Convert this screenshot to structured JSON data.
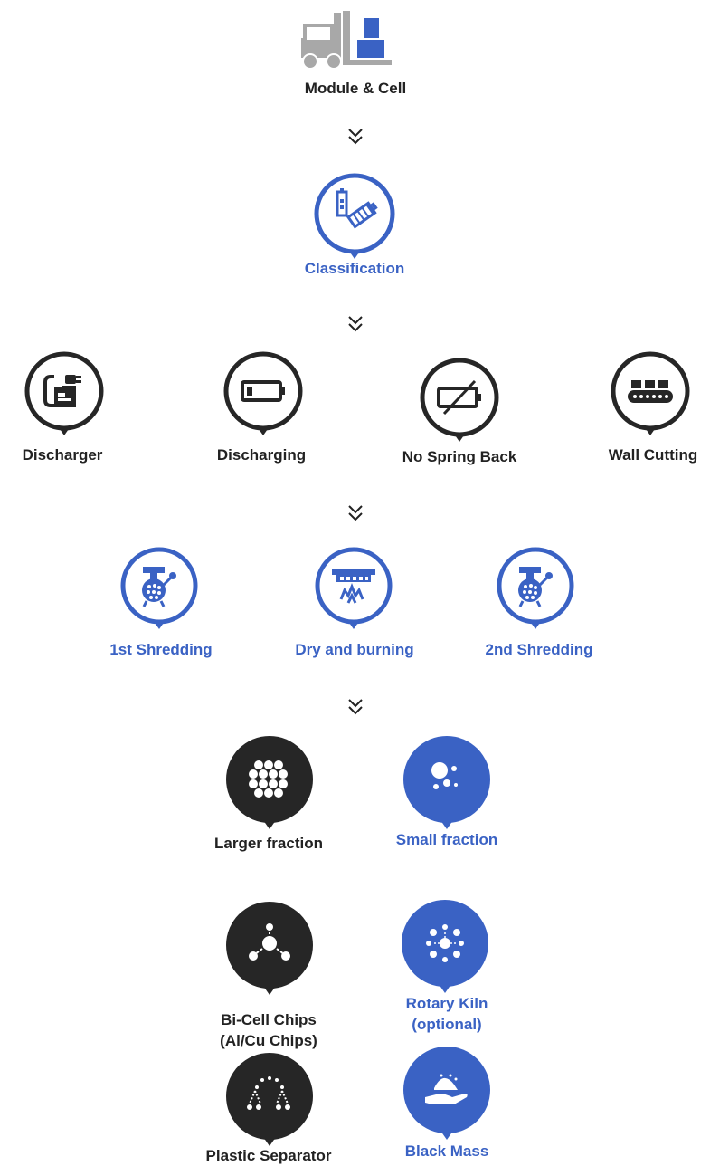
{
  "colors": {
    "blue": "#3a62c4",
    "dark": "#262626",
    "gray": "#a8a8a8",
    "white": "#ffffff"
  },
  "top": {
    "label": "Module & Cell",
    "icon": "forklift-boxes-icon"
  },
  "classification": {
    "label": "Classification",
    "icon": "battery-cells-icon"
  },
  "pre_treatment": [
    {
      "label": "Discharger",
      "icon": "charger-plug-icon"
    },
    {
      "label": "Discharging",
      "icon": "low-battery-icon"
    },
    {
      "label": "No Spring Back",
      "icon": "crossed-battery-icon"
    },
    {
      "label": "Wall Cutting",
      "icon": "conveyor-icon"
    }
  ],
  "processing": [
    {
      "label": "1st Shredding",
      "icon": "shredder-icon"
    },
    {
      "label": "Dry and burning",
      "icon": "furnace-icon"
    },
    {
      "label": "2nd Shredding",
      "icon": "shredder-icon"
    }
  ],
  "outputs": {
    "larger_fraction": {
      "label": "Larger fraction",
      "icon": "chips-cluster-icon"
    },
    "small_fraction": {
      "label": "Small fraction",
      "icon": "particles-icon"
    },
    "bi_cell": {
      "line1": "Bi-Cell Chips",
      "line2": "(Al/Cu Chips)",
      "icon": "molecule-icon"
    },
    "rotary_kiln": {
      "line1": "Rotary Kiln",
      "line2": "(optional)",
      "icon": "kiln-particles-icon"
    },
    "plastic_separator": {
      "label": "Plastic Separator",
      "icon": "separator-icon"
    },
    "black_mass": {
      "label": "Black Mass",
      "icon": "hand-powder-icon"
    }
  }
}
